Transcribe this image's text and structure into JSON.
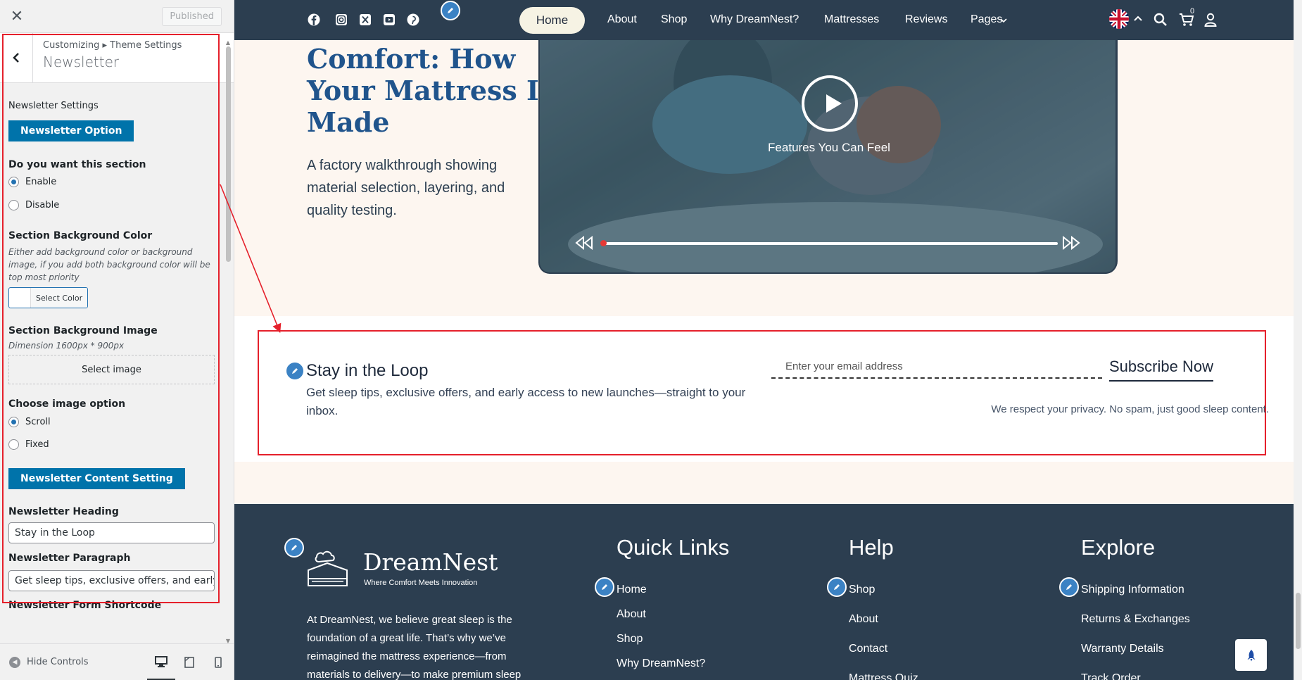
{
  "sidebar": {
    "close_icon": "✕",
    "published": "Published",
    "breadcrumb": "Customizing ▸ Theme Settings",
    "title": "Newsletter",
    "settings_label": "Newsletter Settings",
    "option_button": "Newsletter Option",
    "section_question": "Do you want this section",
    "enable": "Enable",
    "disable": "Disable",
    "bg_color_heading": "Section Background Color",
    "bg_color_desc": "Either add background color or background image, if you add both background color will be top most priority",
    "select_color": "Select Color",
    "bg_image_heading": "Section Background Image",
    "bg_image_desc": "Dimension 1600px * 900px",
    "select_image": "Select image",
    "image_option_heading": "Choose image option",
    "scroll": "Scroll",
    "fixed": "Fixed",
    "content_button": "Newsletter Content Setting",
    "heading_label": "Newsletter Heading",
    "heading_value": "Stay in the Loop",
    "paragraph_label": "Newsletter Paragraph",
    "paragraph_value": "Get sleep tips, exclusive offers, and early ac",
    "shortcode_label": "Newsletter Form Shortcode",
    "hide_controls": "Hide Controls",
    "enable_selected": true,
    "scroll_selected": true
  },
  "nav": {
    "items": [
      "Home",
      "About",
      "Shop",
      "Why DreamNest?",
      "Mattresses",
      "Reviews",
      "Pages"
    ],
    "cart_count": "0"
  },
  "hero": {
    "title_line1": "Comfort: How",
    "title_line2": "Your Mattress Is",
    "title_line3": "Made",
    "desc_line1": "A factory walkthrough showing",
    "desc_line2": "material selection, layering, and",
    "desc_line3": "quality testing.",
    "video_caption": "Features You Can Feel"
  },
  "newsletter": {
    "heading": "Stay in the Loop",
    "paragraph": "Get sleep tips, exclusive offers, and early access to new launches—straight to your inbox.",
    "email_placeholder": "Enter your email address",
    "subscribe": "Subscribe Now",
    "privacy": "We respect your privacy. No spam, just good sleep content."
  },
  "footer": {
    "brand": "DreamNest",
    "tagline": "Where Comfort Meets Innovation",
    "about": "At DreamNest, we believe great sleep is the foundation of a great life. That’s why we’ve reimagined the mattress experience—from materials to delivery—to make premium sleep",
    "quick_links_heading": "Quick Links",
    "quick_links": [
      "Home",
      "About",
      "Shop",
      "Why DreamNest?"
    ],
    "help_heading": "Help",
    "help_links": [
      "Shop",
      "About",
      "Contact",
      "Mattress Quiz"
    ],
    "explore_heading": "Explore",
    "explore_links": [
      "Shipping Information",
      "Returns & Exchanges",
      "Warranty Details",
      "Track Order"
    ]
  },
  "colors": {
    "nav_bg": "#2c3e50",
    "wp_blue": "#0073aa",
    "hero_title": "#20548c",
    "annotation": "#e5202b"
  }
}
